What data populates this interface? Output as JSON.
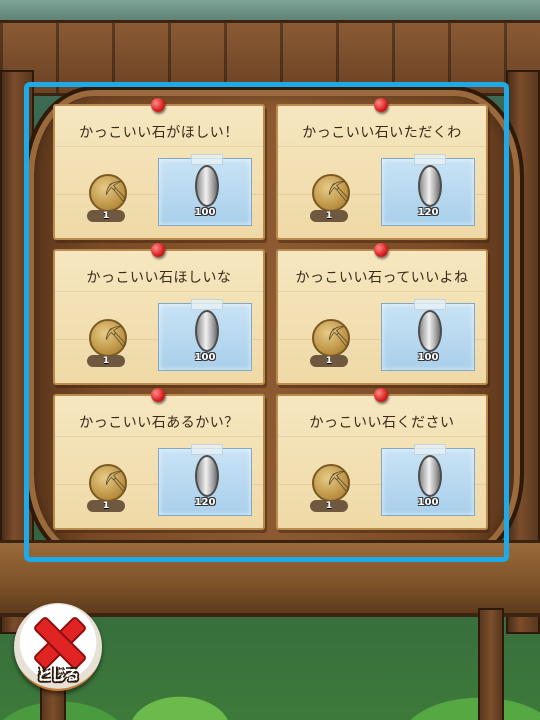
{
  "requests": [
    {
      "title": "かっこいい石がほしい！",
      "item_count": "1",
      "reward": "100"
    },
    {
      "title": "かっこいい石いただくわ",
      "item_count": "1",
      "reward": "120"
    },
    {
      "title": "かっこいい石ほしいな",
      "item_count": "1",
      "reward": "100"
    },
    {
      "title": "かっこいい石っていいよね",
      "item_count": "1",
      "reward": "100"
    },
    {
      "title": "かっこいい石あるかい？",
      "item_count": "1",
      "reward": "120"
    },
    {
      "title": "かっこいい石ください",
      "item_count": "1",
      "reward": "100"
    }
  ],
  "close_button": {
    "label": "とじる"
  },
  "colors": {
    "selection": "#1ea9e8",
    "pin": "#d81e1e",
    "close_x": "#e02424"
  },
  "icons": {
    "item": "pickaxe-icon",
    "reward": "silver-coin-icon",
    "close": "close-x-icon"
  }
}
